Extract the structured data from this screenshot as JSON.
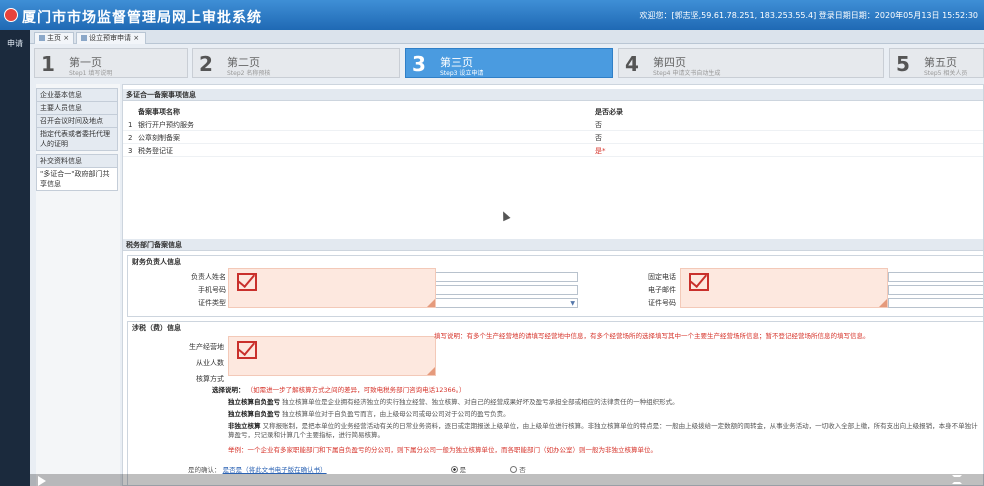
{
  "header": {
    "title": "厦门市市场监督管理局网上审批系统",
    "welcome": "欢迎您：[郭志坚,59.61.78.251, 183.253.55.4] 登录日期日期：2020年05月13日 15:52:30"
  },
  "rail": {
    "label": "申请"
  },
  "tabs": [
    {
      "label": "主页"
    },
    {
      "label": "设立预审申请"
    }
  ],
  "steps": [
    {
      "num": "1",
      "title": "第一页",
      "sub": "Step1 填写说明"
    },
    {
      "num": "2",
      "title": "第二页",
      "sub": "Step2 名称预核"
    },
    {
      "num": "3",
      "title": "第三页",
      "sub": "Step3 设立申请"
    },
    {
      "num": "4",
      "title": "第四页",
      "sub": "Step4 申请文书自动生成"
    },
    {
      "num": "5",
      "title": "第五页",
      "sub": "Step5 相关人员"
    }
  ],
  "sidenav": [
    "企业基本信息",
    "主要人员信息",
    "召开会议时间及地点",
    "指定代表或者委托代理人的证明",
    "补交资料信息",
    "\"多证合一\"政府部门共享信息"
  ],
  "multi_section": {
    "title": "多证合一备案事项信息",
    "col_name": "备案事项名称",
    "col_required": "是否必录",
    "rows": [
      {
        "idx": "1",
        "name": "银行开户预约服务",
        "required": "否"
      },
      {
        "idx": "2",
        "name": "公章刻制备案",
        "required": "否"
      },
      {
        "idx": "3",
        "name": "税务登记证",
        "required": "是*"
      }
    ]
  },
  "tax_section": {
    "title": "税务部门备案信息",
    "finance_group": {
      "title": "财务负责人信息",
      "name_label": "负责人姓名",
      "phone_label": "手机号码",
      "idtype_label": "证件类型",
      "fixed_phone_label": "固定电话",
      "email_label": "电子邮件",
      "idno_label": "证件号码"
    },
    "tax_group": {
      "title": "涉税（费）信息",
      "industry_label": "生产经营地",
      "staff_label": "从业人数",
      "accounting_label": "核算方式",
      "hint": "填写说明：有多个生产经营地的请填写经营地中信息，有多个经营场所的选择填写其中一个主要生产经营场所信息；暂不登记经营场所信息的填写信息。",
      "explain_title": "选择说明：",
      "explain_tip": "（如需进一步了解核算方式之间的差异，可致电税务部门咨询电话12366。）",
      "item1_title": "独立核算自负盈亏",
      "item1_text": "独立核算单位是企业拥有经济独立的实行独立经营、独立核算、对自己的经营成果好坏及盈亏承担全部或相应的法律责任的一种组织形式。",
      "item2_title": "独立核算自负盈亏",
      "item2_text": "独立核算单位对于自负盈亏而言，由上级母公司或母公司对于公司的盈亏负责。",
      "item3_title": "非独立核算",
      "item3_text": "又称报账制，是把本单位的业务经营活动有关的日常业务资料，逐日或定期报送上级单位，由上级单位进行核算。非独立核算单位的特点是：一般由上级拨给一定数额的周转金，从事业务活动，一切收入全部上缴，所有支出向上级报销，本身不单独计算盈亏，只记录和计算几个主要指标，进行简易核算。",
      "note_text": "举例：一个企业有多家职能部门和下属自负盈亏的分公司，则下属分公司一般为独立核算单位，而各职能部门（如办公室）则一般为非独立核算单位。",
      "confirm_label": "是的确认：",
      "confirm_link": "是否是（将此文书电子版在确认书）",
      "yes": "是",
      "no": "否"
    }
  }
}
